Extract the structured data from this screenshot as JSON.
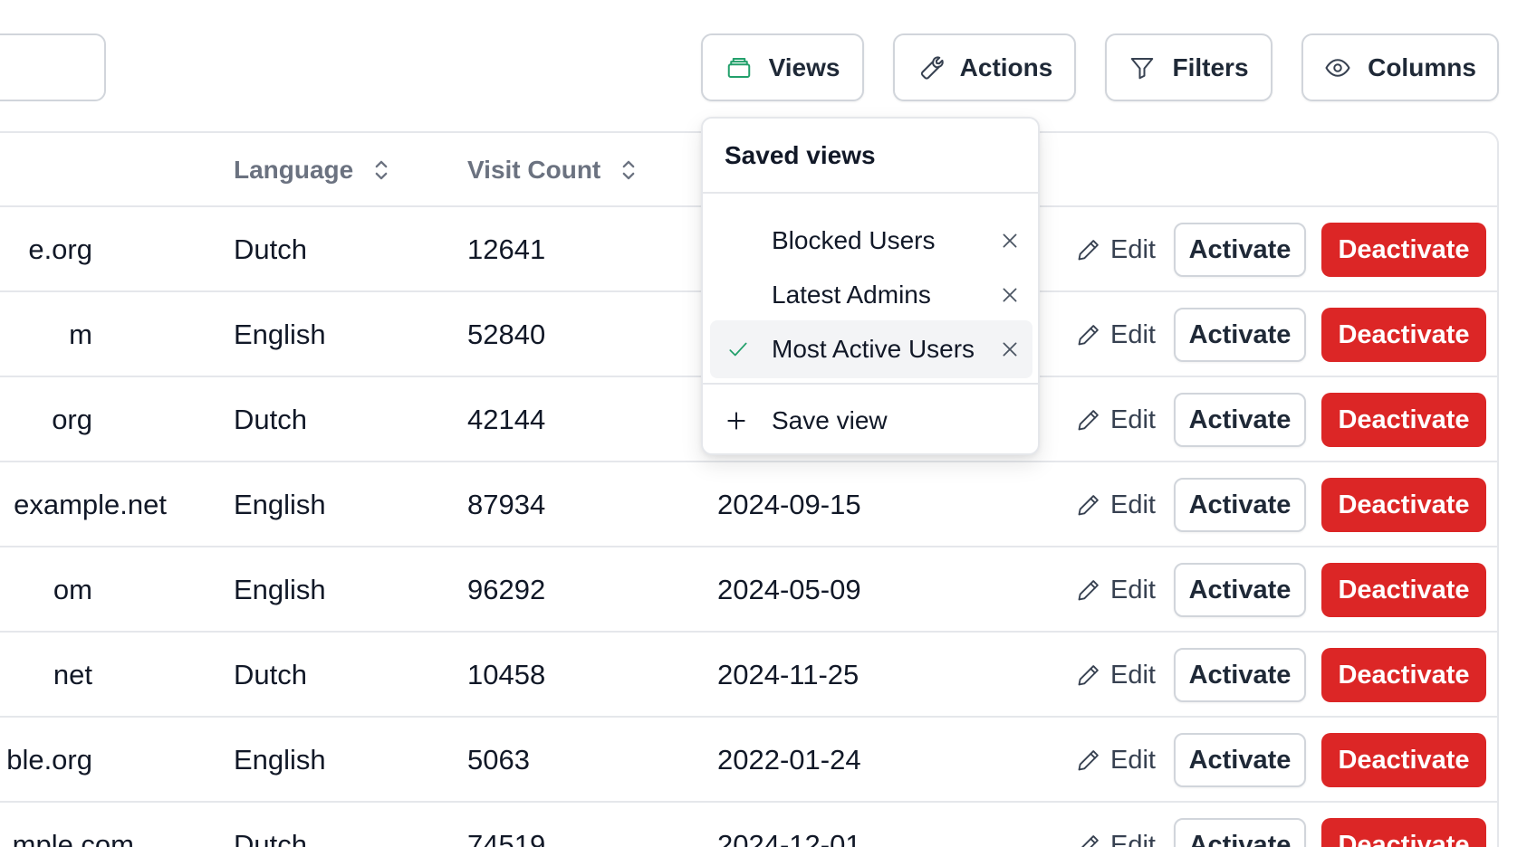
{
  "toolbar": {
    "views_label": "Views",
    "actions_label": "Actions",
    "filters_label": "Filters",
    "columns_label": "Columns",
    "views_icon_color": "#22a06b"
  },
  "table": {
    "headers": {
      "language": "Language",
      "visit_count": "Visit Count"
    },
    "edit_label": "Edit",
    "activate_label": "Activate",
    "deactivate_label": "Deactivate",
    "rows": [
      {
        "email": "e.org",
        "language": "Dutch",
        "visits": "12641",
        "date": ""
      },
      {
        "email": "m",
        "language": "English",
        "visits": "52840",
        "date": ""
      },
      {
        "email": "org",
        "language": "Dutch",
        "visits": "42144",
        "date": ""
      },
      {
        "email": "example.net",
        "language": "English",
        "visits": "87934",
        "date": "2024-09-15"
      },
      {
        "email": "om",
        "language": "English",
        "visits": "96292",
        "date": "2024-05-09"
      },
      {
        "email": "net",
        "language": "Dutch",
        "visits": "10458",
        "date": "2024-11-25"
      },
      {
        "email": "ble.org",
        "language": "English",
        "visits": "5063",
        "date": "2022-01-24"
      },
      {
        "email": "mple.com",
        "language": "Dutch",
        "visits": "74519",
        "date": "2024-12-01"
      }
    ]
  },
  "views_dropdown": {
    "title": "Saved views",
    "items": [
      {
        "label": "Blocked Users",
        "selected": false
      },
      {
        "label": "Latest Admins",
        "selected": false
      },
      {
        "label": "Most Active Users",
        "selected": true
      }
    ],
    "save_label": "Save view",
    "check_color": "#22a06b"
  }
}
